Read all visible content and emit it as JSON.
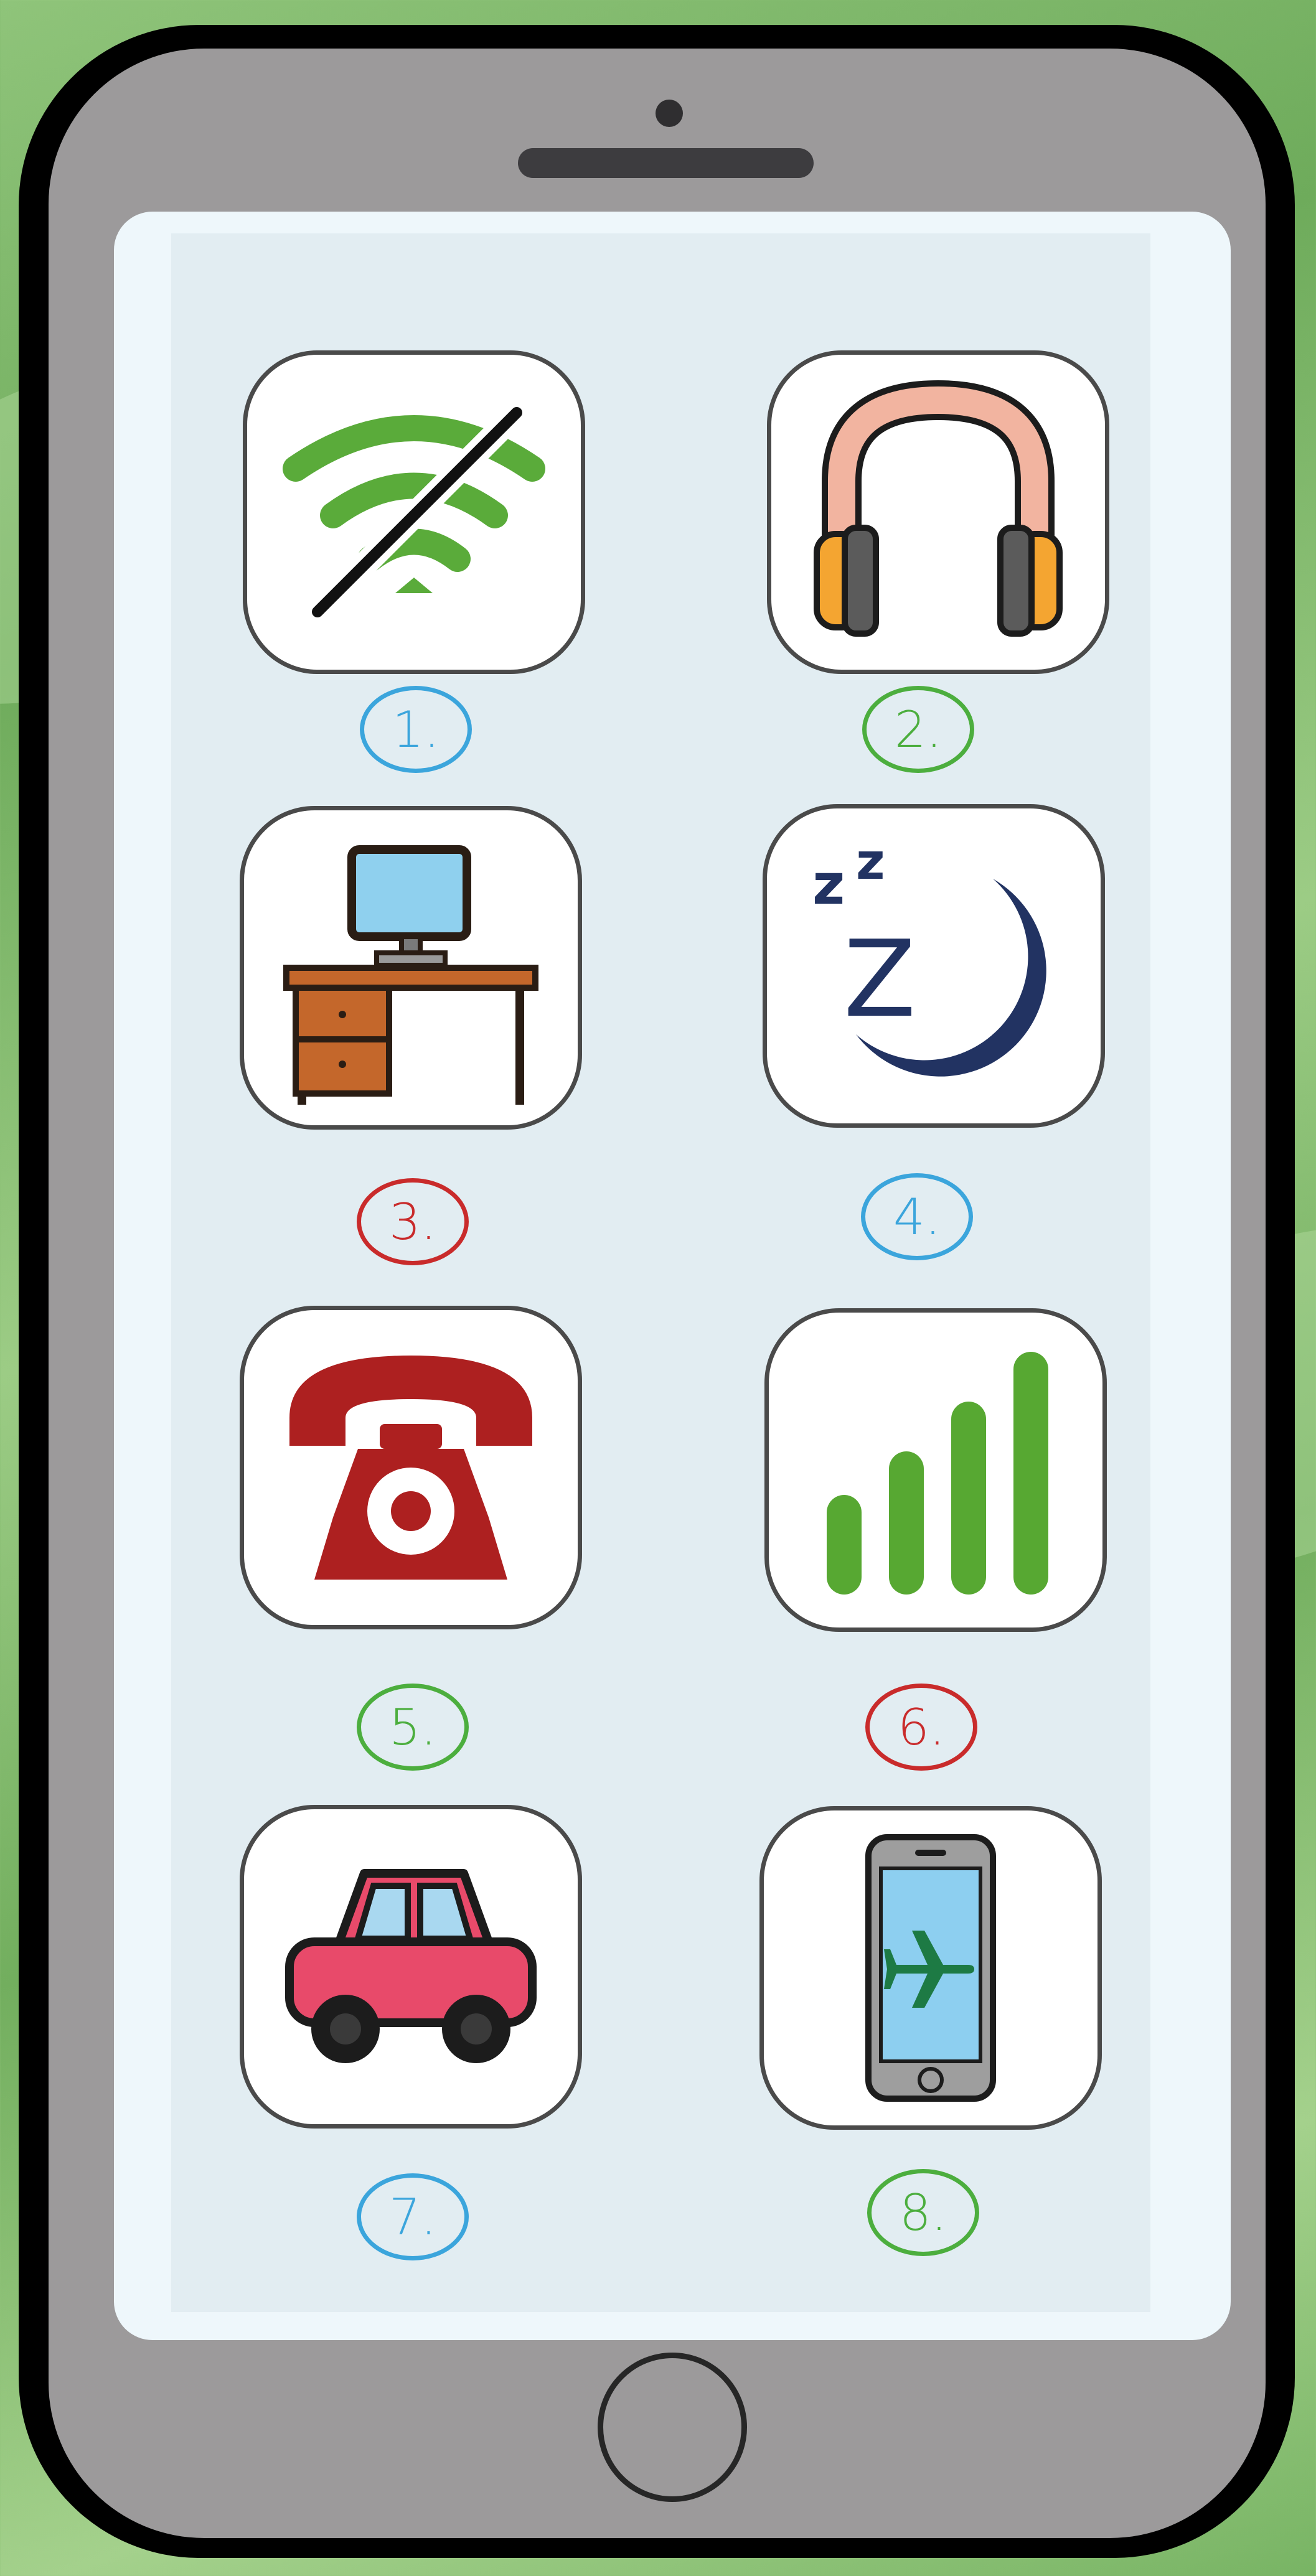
{
  "apps": [
    {
      "label": "1.",
      "icon": "no-wifi-icon",
      "color": "#3ba5dc"
    },
    {
      "label": "2.",
      "icon": "headphones-icon",
      "color": "#4cae3e"
    },
    {
      "label": "3.",
      "icon": "desk-computer-icon",
      "color": "#c92b2b"
    },
    {
      "label": "4.",
      "icon": "moon-sleep-icon",
      "color": "#3ba5dc"
    },
    {
      "label": "5.",
      "icon": "telephone-icon",
      "color": "#4cae3e"
    },
    {
      "label": "6.",
      "icon": "signal-bars-icon",
      "color": "#c92b2b"
    },
    {
      "label": "7.",
      "icon": "car-icon",
      "color": "#3ba5dc"
    },
    {
      "label": "8.",
      "icon": "airplane-mode-icon",
      "color": "#4cae3e"
    }
  ],
  "sleep_icon_text": [
    "z",
    "z",
    "Z"
  ],
  "colors": {
    "phone_body": "#9c9a9b",
    "screen": "#eef7fb",
    "background_green": "#7db866"
  }
}
